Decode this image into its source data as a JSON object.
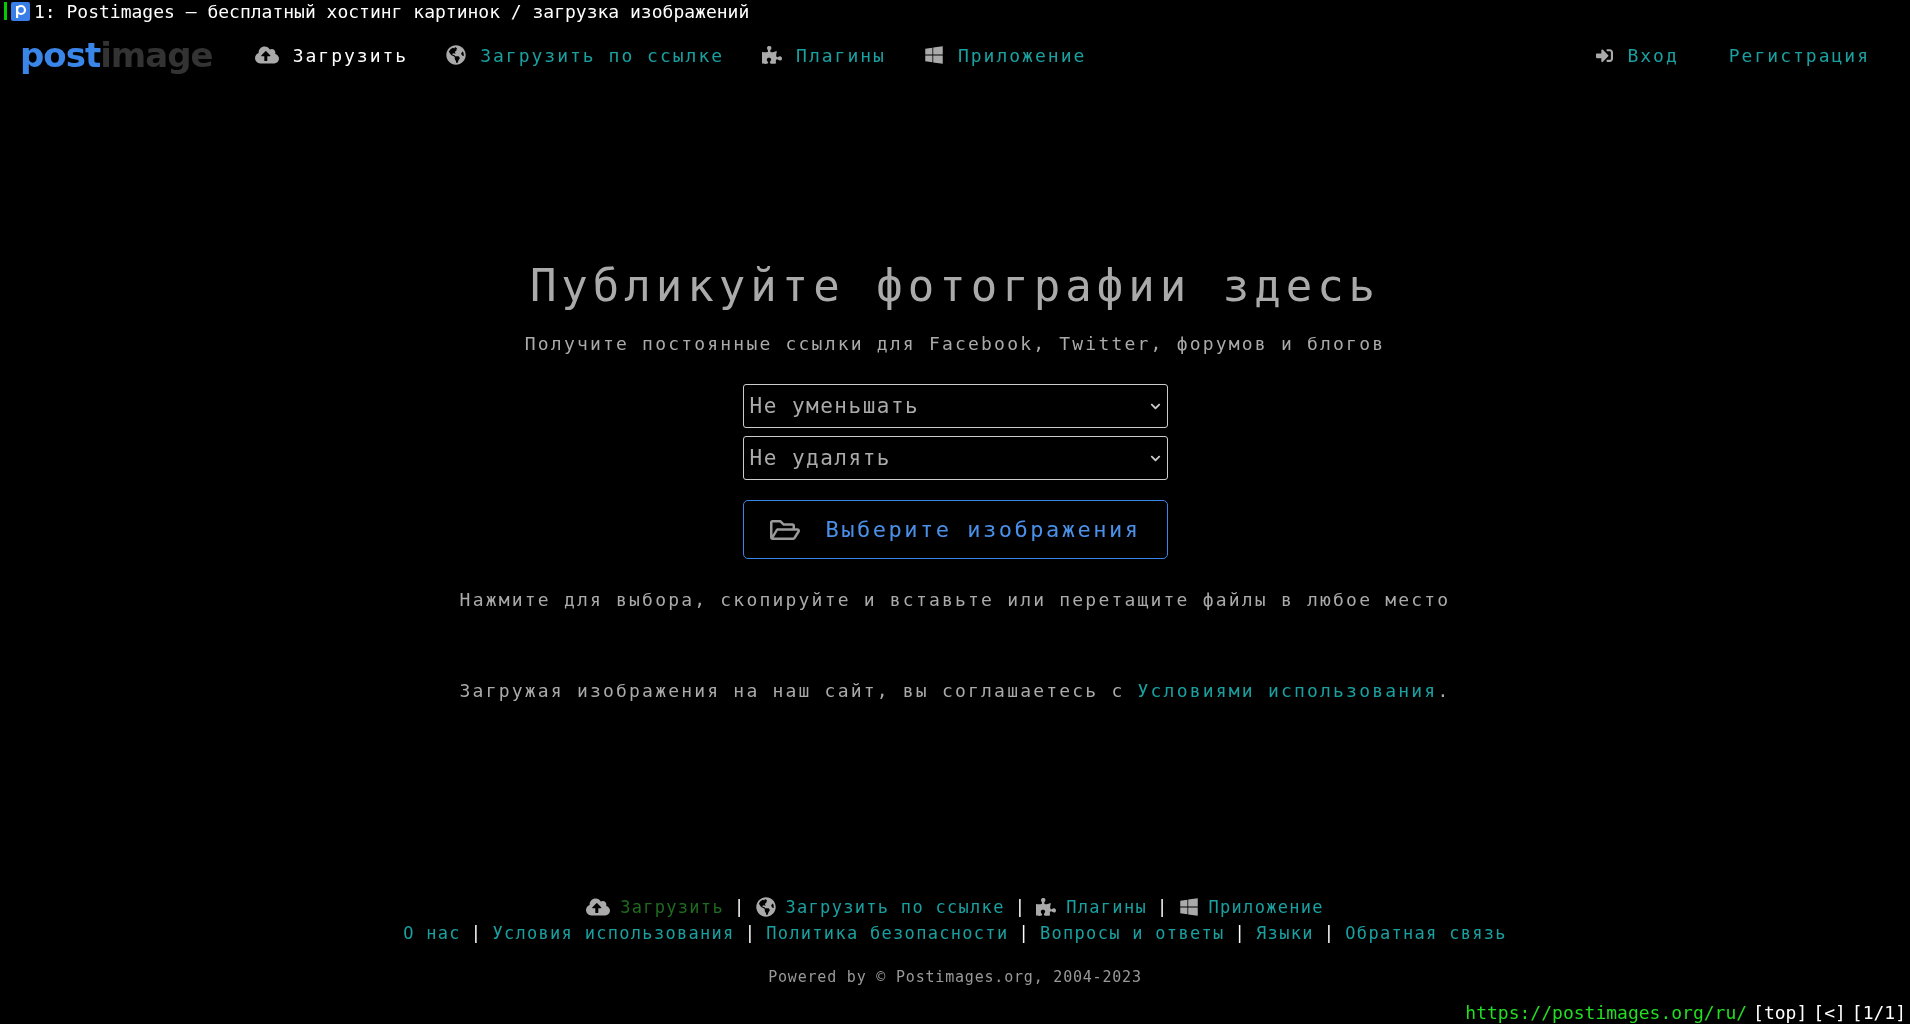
{
  "tab_bar": {
    "title": "1: Postimages — бесплатный хостинг картинок / загрузка изображений"
  },
  "logo": {
    "primary": "post",
    "secondary": "image"
  },
  "nav": [
    {
      "kind": "upload",
      "label": "Загрузить",
      "selected": true
    },
    {
      "kind": "link",
      "label": "Загрузить по ссылке",
      "selected": false
    },
    {
      "kind": "plugins",
      "label": "Плагины",
      "selected": false
    },
    {
      "kind": "app",
      "label": "Приложение",
      "selected": false
    }
  ],
  "account": [
    {
      "kind": "login",
      "label": "Вход"
    },
    {
      "kind": "register",
      "label": "Регистрация"
    }
  ],
  "hero": {
    "title": "Публикуйте фотографии здесь",
    "subtitle": "Получите постоянные ссылки для Facebook, Twitter, форумов и блогов"
  },
  "selects": [
    {
      "value": "Не уменьшать"
    },
    {
      "value": "Не удалять"
    }
  ],
  "choose_button": {
    "label": "Выберите изображения"
  },
  "hint": "Нажмите для выбора, скопируйте и вставьте или перетащите файлы в любое место",
  "terms": {
    "text": "Загружая изображения на наш сайт, вы соглашаетесь с",
    "link": "Условиями использования",
    "end": "."
  },
  "footer_nav": [
    {
      "kind": "upload",
      "label": "Загрузить",
      "selected": true
    },
    {
      "kind": "link",
      "label": "Загрузить по ссылке",
      "selected": false
    },
    {
      "kind": "plugins",
      "label": "Плагины",
      "selected": false
    },
    {
      "kind": "app",
      "label": "Приложение",
      "selected": false
    }
  ],
  "footer_links": [
    "О нас",
    "Условия использования",
    "Политика безопасности",
    "Вопросы и ответы",
    "Языки",
    "Обратная связь"
  ],
  "separator": "|",
  "powered": "Powered by © Postimages.org, 2004-2023",
  "status_bar": {
    "url": "https://postimages.org/ru/",
    "controls": [
      "[top]",
      "[<]",
      "[1/1]"
    ]
  }
}
